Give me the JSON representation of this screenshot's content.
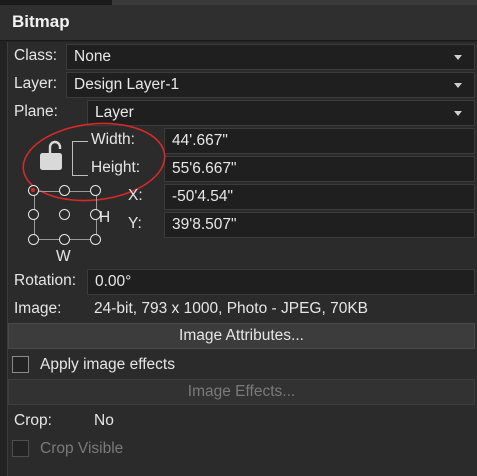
{
  "header": {
    "title": "Bitmap"
  },
  "class": {
    "label": "Class:",
    "value": "None"
  },
  "layer": {
    "label": "Layer:",
    "value": "Design Layer-1"
  },
  "plane": {
    "label": "Plane:",
    "value": "Layer"
  },
  "width": {
    "label": "Width:",
    "value": "44'.667\""
  },
  "height": {
    "label": "Height:",
    "value": "55'6.667\""
  },
  "x": {
    "label": "X:",
    "value": "-50'4.54\""
  },
  "y": {
    "label": "Y:",
    "value": "39'8.507\""
  },
  "position_box": {
    "h_label": "H",
    "w_label": "W"
  },
  "rotation": {
    "label": "Rotation:",
    "value": "0.00°"
  },
  "image": {
    "label": "Image:",
    "value": "24-bit, 793 x 1000, Photo - JPEG, 70KB"
  },
  "buttons": {
    "image_attributes": "Image Attributes...",
    "image_effects": "Image Effects..."
  },
  "apply_effects": {
    "label": "Apply image effects",
    "checked": false
  },
  "crop": {
    "label": "Crop:",
    "value": "No"
  },
  "crop_visible": {
    "label": "Crop Visible",
    "checked": false,
    "enabled": false
  },
  "colors": {
    "annotation": "#d42a2a",
    "background": "#2b2b2b"
  },
  "icons": {
    "lock": "unlocked-padlock-icon"
  }
}
